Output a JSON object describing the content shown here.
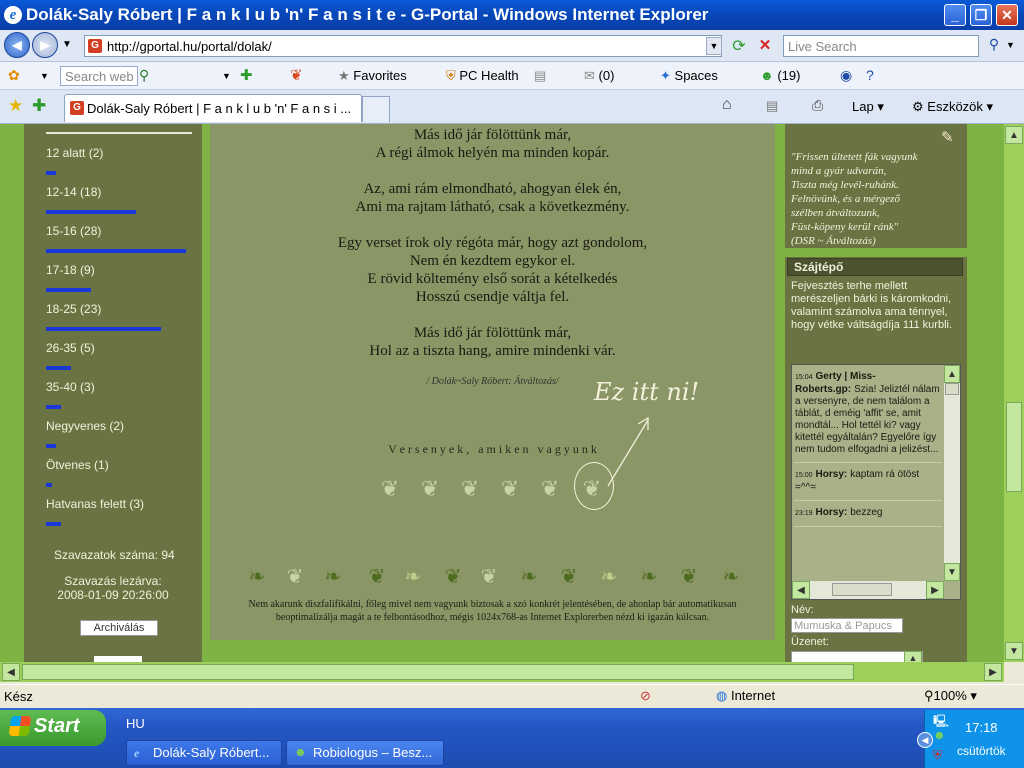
{
  "window": {
    "title": "Dolák-Saly Róbert | F a n k l u b 'n' F a n s i t e - G-Portal - Windows Internet Explorer",
    "minimize": "_",
    "maximize": "❐",
    "close": "✕"
  },
  "address_bar": {
    "back": "◀",
    "forward": "▶",
    "url": "http://gportal.hu/portal/dolak/",
    "search_placeholder": "Live Search"
  },
  "links_bar": {
    "search_placeholder": "Search web",
    "favorites": "Favorites",
    "pc_health": "PC Health",
    "mail": "(0)",
    "spaces": "Spaces",
    "contacts": "(19)"
  },
  "tabs": {
    "active_label": "Dolák-Saly Róbert | F a n k l u b 'n' F a n s i ...",
    "lap": "Lap",
    "eszkozok": "Eszközök"
  },
  "poll": {
    "items": [
      {
        "label": "12 alatt (2)",
        "fraction": 0.07
      },
      {
        "label": "12-14 (18)",
        "fraction": 0.64
      },
      {
        "label": "15-16 (28)",
        "fraction": 1.0
      },
      {
        "label": "17-18 (9)",
        "fraction": 0.32
      },
      {
        "label": "18-25 (23)",
        "fraction": 0.82
      },
      {
        "label": "26-35 (5)",
        "fraction": 0.18
      },
      {
        "label": "35-40 (3)",
        "fraction": 0.11
      },
      {
        "label": "Negyvenes (2)",
        "fraction": 0.07
      },
      {
        "label": "Ötvenes (1)",
        "fraction": 0.04
      },
      {
        "label": "Hatvanas felett (3)",
        "fraction": 0.11
      }
    ],
    "votes": "Szavazatok száma: 94",
    "closing_label": "Szavazás lezárva:",
    "closing_date": "2008-01-09 20:26:00",
    "archive_button": "Archiválás"
  },
  "poem": {
    "stanza1": [
      "Más idő jár fölöttünk már,",
      "A régi álmok helyén ma minden kopár."
    ],
    "stanza2": [
      "Az, ami rám elmondható, ahogyan élek én,",
      "Ami ma rajtam látható, csak a következmény."
    ],
    "stanza3": [
      "Egy verset írok oly régóta már, hogy azt gondolom,",
      "Nem én kezdtem egykor el.",
      "E rövid költemény első sorát a kételkedés",
      "Hosszú csendje váltja fel."
    ],
    "stanza4": [
      "Más idő jár fölöttünk már,",
      "Hol az a tiszta hang, amire mindenki vár."
    ],
    "attribution": "/ Dolák~Saly Róbert: Átváltozás/",
    "handwritten": "Ez itt ni!",
    "competitions": "V e r s e n y e k ,   a m i k e n   v a g y u n k",
    "footer_note": "Nem akarunk diszfalifikálni, főleg mivel nem vagyunk biztosak a szó konkrét jelentésében, de  ahonlap bár automatikusan beoptimalizálja magát a te felbontásodhoz, mégis 1024x768-as Internet Explorerben nézd ki igazán kúlcsan."
  },
  "quote": {
    "lines": [
      "\"Frissen ültetett fák vagyunk",
      "mind a gyár udvarán,",
      "Tiszta még levél-ruhánk.",
      "Felnövünk, és a mérgező",
      "szélben átváltozunk,",
      "Füst-köpeny kerül ránk\"",
      "(DSR ~ Átváltozás)"
    ]
  },
  "shoutbox": {
    "title": "Szájtépő",
    "description": "Fejvesztés terhe mellett merészeljen bárki is káromkodni, valamint számolva ama ténnyel, hogy vétke váltságdíja 111 kurbli.",
    "messages": [
      {
        "time": "15:04",
        "author": "Gerty | Miss-Roberts.gp:",
        "text": "Szia! Jeliztél nálam a versenyre, de nem találom a táblát, d eméig 'affit' se, amit mondtál... Hol tettél ki? vagy kitettél egyáltalán? Egyelőre így nem tudom elfogadni a jelizést..."
      },
      {
        "time": "15:00",
        "author": "Horsy:",
        "text": "kaptam rá ötöst =^^="
      },
      {
        "time": "23:19",
        "author": "Horsy:",
        "text": "bezzeg"
      }
    ],
    "name_label": "Név:",
    "name_value": "Mumuska & Papucs",
    "message_label": "Üzenet:"
  },
  "statusbar": {
    "status": "Kész",
    "zone": "Internet",
    "zoom": "100%"
  },
  "taskbar": {
    "start": "Start",
    "lang": "HU",
    "tasks": [
      "Dolák-Saly Róbert...",
      "Robiologus – Besz..."
    ],
    "time": "17:18",
    "day": "csütörtök"
  }
}
